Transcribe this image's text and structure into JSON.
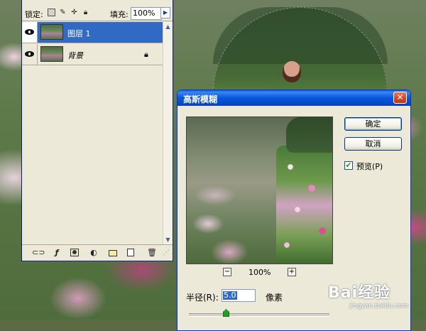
{
  "layers_panel": {
    "lock_label": "锁定:",
    "fill_label": "填充:",
    "fill_value": "100%",
    "layers": [
      {
        "name": "图层 1",
        "selected": true,
        "visible": true
      },
      {
        "name": "背景",
        "selected": false,
        "visible": true,
        "locked": true
      }
    ],
    "icons": {
      "lock_transparent": "transparent-lock-icon",
      "lock_paint": "brush-lock-icon",
      "lock_move": "move-lock-icon",
      "lock_all": "padlock-icon",
      "eye": "eye-icon",
      "link": "link-icon",
      "fx": "fx-icon",
      "mask": "mask-icon",
      "adjust": "adjustment-icon",
      "folder": "folder-icon",
      "new_layer": "new-layer-icon",
      "trash": "trash-icon"
    }
  },
  "blur_dialog": {
    "title": "高斯模糊",
    "ok_label": "确定",
    "cancel_label": "取消",
    "preview_label": "预览(P)",
    "preview_checked": true,
    "zoom_out_symbol": "−",
    "zoom_in_symbol": "+",
    "zoom_level": "100%",
    "radius_label": "半径(R):",
    "radius_value": "5.0",
    "radius_unit": "像素",
    "close_symbol": "✕"
  },
  "watermark": {
    "logo": "Bai经验",
    "url": "jingyan.baidu.com"
  },
  "colors": {
    "titlebar": "#0855dd",
    "selection": "#316ac5",
    "panel_bg": "#ece9d8"
  }
}
